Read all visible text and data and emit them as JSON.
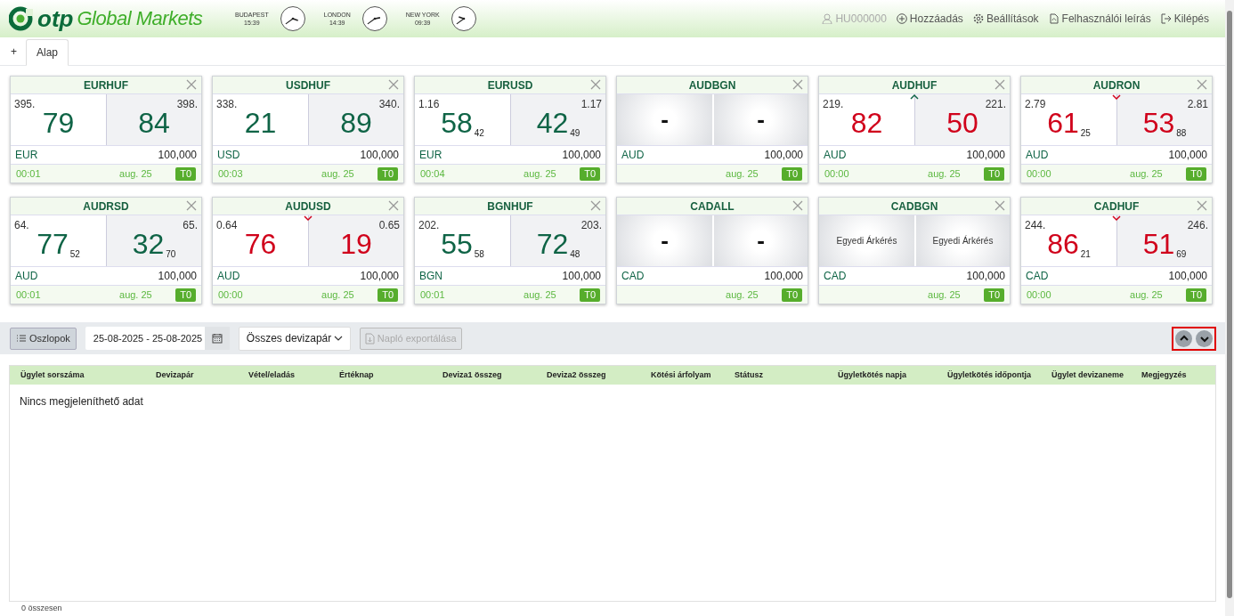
{
  "header": {
    "logo_mark": "otp",
    "logo_text": "Global Markets",
    "clocks": [
      {
        "city": "BUDAPEST",
        "time": "15:39"
      },
      {
        "city": "LONDON",
        "time": "14:39"
      },
      {
        "city": "NEW YORK",
        "time": "09:39"
      }
    ],
    "user": "HU000000",
    "links": [
      {
        "kind": "add",
        "label": "Hozzáadás"
      },
      {
        "kind": "settings",
        "label": "Beállítások"
      },
      {
        "kind": "manual",
        "label": "Felhasználói leírás"
      },
      {
        "kind": "logout",
        "label": "Kilépés"
      }
    ]
  },
  "tabs": [
    {
      "label": "+",
      "selected": false
    },
    {
      "label": "Alap",
      "selected": true
    }
  ],
  "tiles": [
    {
      "pair": "EURHUF",
      "kind": "price",
      "changed": false,
      "up_tick": false,
      "down_tick": false,
      "bid": {
        "prefix": "395.",
        "big": "79"
      },
      "ask": {
        "prefix": "398.",
        "big": "84"
      },
      "currency": "EUR",
      "amount": "100,000",
      "time": "00:01",
      "date": "aug. 25",
      "tenor": "T0"
    },
    {
      "pair": "USDHUF",
      "kind": "price",
      "changed": false,
      "up_tick": false,
      "down_tick": false,
      "bid": {
        "prefix": "338.",
        "big": "21"
      },
      "ask": {
        "prefix": "340.",
        "big": "89"
      },
      "currency": "USD",
      "amount": "100,000",
      "time": "00:03",
      "date": "aug. 25",
      "tenor": "T0"
    },
    {
      "pair": "EURUSD",
      "kind": "price",
      "changed": false,
      "up_tick": false,
      "down_tick": false,
      "bid": {
        "prefix": "1.16",
        "big": "58",
        "small": "42"
      },
      "ask": {
        "prefix": "1.17",
        "big": "42",
        "small": "49"
      },
      "currency": "EUR",
      "amount": "100,000",
      "time": "00:04",
      "date": "aug. 25",
      "tenor": "T0"
    },
    {
      "pair": "AUDBGN",
      "kind": "empty",
      "bid": {
        "big": "-"
      },
      "ask": {
        "big": "-"
      },
      "currency": "AUD",
      "amount": "100,000",
      "date": "aug. 25",
      "tenor": "T0"
    },
    {
      "pair": "AUDHUF",
      "kind": "price",
      "changed": true,
      "up_tick": true,
      "down_tick": false,
      "bid": {
        "prefix": "219.",
        "big": "82"
      },
      "ask": {
        "prefix": "221.",
        "big": "50"
      },
      "currency": "AUD",
      "amount": "100,000",
      "time": "00:00",
      "date": "aug. 25",
      "tenor": "T0"
    },
    {
      "pair": "AUDRON",
      "kind": "price",
      "changed": true,
      "up_tick": false,
      "down_tick": true,
      "bid": {
        "prefix": "2.79",
        "big": "61",
        "small": "25"
      },
      "ask": {
        "prefix": "2.81",
        "big": "53",
        "small": "88"
      },
      "currency": "AUD",
      "amount": "100,000",
      "time": "00:00",
      "date": "aug. 25",
      "tenor": "T0"
    },
    {
      "pair": "AUDRSD",
      "kind": "price",
      "changed": false,
      "up_tick": false,
      "down_tick": false,
      "bid": {
        "prefix": "64.",
        "big": "77",
        "small": "52"
      },
      "ask": {
        "prefix": "65.",
        "big": "32",
        "small": "70"
      },
      "currency": "AUD",
      "amount": "100,000",
      "time": "00:01",
      "date": "aug. 25",
      "tenor": "T0"
    },
    {
      "pair": "AUDUSD",
      "kind": "price",
      "changed": true,
      "up_tick": false,
      "down_tick": true,
      "bid": {
        "prefix": "0.64",
        "big": "76"
      },
      "ask": {
        "prefix": "0.65",
        "big": "19"
      },
      "currency": "AUD",
      "amount": "100,000",
      "time": "00:00",
      "date": "aug. 25",
      "tenor": "T0"
    },
    {
      "pair": "BGNHUF",
      "kind": "price",
      "changed": false,
      "up_tick": false,
      "down_tick": false,
      "bid": {
        "prefix": "202.",
        "big": "55",
        "small": "58"
      },
      "ask": {
        "prefix": "203.",
        "big": "72",
        "small": "48"
      },
      "currency": "BGN",
      "amount": "100,000",
      "time": "00:01",
      "date": "aug. 25",
      "tenor": "T0"
    },
    {
      "pair": "CADALL",
      "kind": "empty",
      "bid": {
        "big": "-"
      },
      "ask": {
        "big": "-"
      },
      "currency": "CAD",
      "amount": "100,000",
      "date": "aug. 25",
      "tenor": "T0"
    },
    {
      "pair": "CADBGN",
      "kind": "request",
      "bid": {
        "label": "Egyedi Árkérés"
      },
      "ask": {
        "label": "Egyedi Árkérés"
      },
      "currency": "CAD",
      "amount": "100,000",
      "date": "aug. 25",
      "tenor": "T0"
    },
    {
      "pair": "CADHUF",
      "kind": "price",
      "changed": true,
      "up_tick": false,
      "down_tick": true,
      "bid": {
        "prefix": "244.",
        "big": "86",
        "small": "21"
      },
      "ask": {
        "prefix": "246.",
        "big": "51",
        "small": "69"
      },
      "currency": "CAD",
      "amount": "100,000",
      "time": "00:00",
      "date": "aug. 25",
      "tenor": "T0"
    }
  ],
  "toolbar": {
    "columns_button": "Oszlopok",
    "date_range": "25-08-2025 - 25-08-2025",
    "pair_select": "Összes devizapár",
    "export_button": "Napló exportálása",
    "export_disabled": true
  },
  "table": {
    "columns": [
      "Ügylet sorszáma",
      "Devizapár",
      "Vétel/eladás",
      "Értéknap",
      "Deviza1 összeg",
      "Deviza2 összeg",
      "Kötési árfolyam",
      "Státusz",
      "Ügyletkötés napja",
      "Ügyletkötés időpontja",
      "Ügylet devizaneme",
      "Megjegyzés"
    ],
    "empty_message": "Nincs megjeleníthető adat"
  },
  "status_bar": "0 összesen"
}
